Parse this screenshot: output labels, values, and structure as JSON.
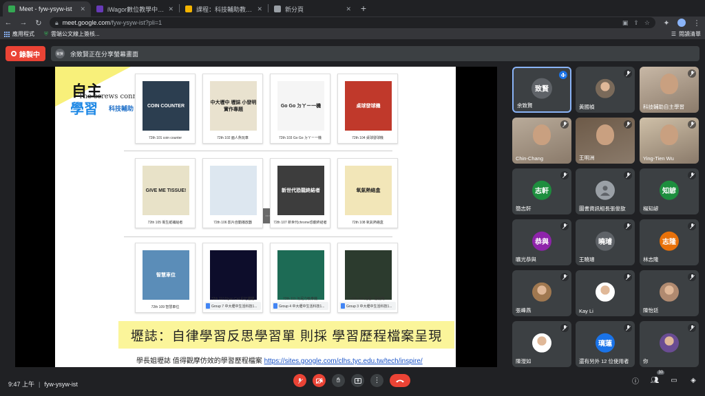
{
  "browser": {
    "tabs": [
      {
        "title": "Meet - fyw-ysyw-ist",
        "color": "#34a853",
        "active": true
      },
      {
        "title": "iWagor數位教學中心 » Categ",
        "color": "#673ab7",
        "active": false
      },
      {
        "title": "課程：科技輔助教學教案成果區",
        "color": "#f4b400",
        "active": false
      },
      {
        "title": "新分頁",
        "color": "#9aa0a6",
        "active": false
      }
    ],
    "new_tab": "+",
    "url_host": "meet.google.com",
    "url_path": "/fyw-ysyw-ist?pli=1",
    "bookmarks": [
      {
        "label": "應用程式"
      },
      {
        "label": "雲端公文線上簽核..."
      }
    ],
    "reading_list": "閱讀清單"
  },
  "meet": {
    "record_label": "錄製中",
    "share_avatar": "致賢",
    "share_banner": "余致賢正在分享螢幕畫面",
    "meeting_time": "9:47 上午",
    "meeting_code": "fyw-ysyw-ist",
    "people_count": "30"
  },
  "slide": {
    "title_black": "自主",
    "title_blue": "學習",
    "subtitle_en": "The screws connect the world",
    "subtitle_zh": "科技輔助",
    "cards_row1": [
      {
        "caption": "72th 101 coin counter",
        "thumb_text": "COIN COUNTER",
        "color": "#2c3e50"
      },
      {
        "caption": "72th 102 面人魚玩車",
        "thumb_text": "中大壢中 壢誌 小發明實作專題",
        "color": "#e9e2cf"
      },
      {
        "caption": "72th 103 Go Go ㄉㄚㄧ一機",
        "thumb_text": "Go Go ㄉㄚㄧ一機",
        "color": "#f5f5f5"
      },
      {
        "caption": "72th 104 桌球發球機",
        "thumb_text": "桌球發球機",
        "color": "#c0392b"
      }
    ],
    "cards_row2": [
      {
        "caption": "72th 105 衛生紙補給者",
        "thumb_text": "GIVE ME TISSUE!",
        "color": "#e8e2c8"
      },
      {
        "caption": "72th 106 影片自動播放器",
        "thumb_text": "",
        "color": "#dde7f0"
      },
      {
        "caption": "72th 107 新世代chrome恐龍終結者",
        "thumb_text": "新世代恐龍終結者",
        "color": "#3d3d3d"
      },
      {
        "caption": "72th 108 氧氣熱絡盒",
        "thumb_text": "氧氣熱絡盒",
        "color": "#f2e6b8"
      }
    ],
    "cards_row3": [
      {
        "caption": "72th 109 智慧車位",
        "thumb_text": "智慧車位",
        "color": "#5b8db8",
        "doc": ""
      },
      {
        "caption": "72th 110 Nyan Cat 彩虹貓貓",
        "thumb_text": "",
        "color": "#0d0d2b",
        "doc": "Group 7 中大壢中生活科技1..."
      },
      {
        "caption": "72th 111 污泥力吸車機",
        "thumb_text": "",
        "color": "#1d6b55",
        "doc": "Group 4 中大壢中生活科技1..."
      },
      {
        "caption": "72th 111 光遮 · 雷射筒",
        "thumb_text": "",
        "color": "#2c3b2e",
        "doc": "Group 3 中大壢中生活科技1..."
      }
    ],
    "banner": "壢誌：自律學習反思學習單 則採 學習歷程檔案呈現",
    "footer_text": "學長姐壢誌  值得觀摩仿效的學習歷程檔案  ",
    "footer_link": "https://sites.google.com/clhs.tyc.edu.tw/tech/inspire/",
    "overlay_left": "返回",
    "overlay_right": "⋯"
  },
  "participants": [
    {
      "name": "余致賢",
      "avatar": "致賢",
      "color": "#5f6368",
      "speaking": true,
      "video": false
    },
    {
      "name": "黃國禎",
      "avatar": "",
      "color": "#7a6a5a",
      "speaking": false,
      "video": false,
      "photo": true
    },
    {
      "name": "科技輔助自主學習",
      "avatar": "",
      "color": "#c8b8a6",
      "speaking": false,
      "video": true
    },
    {
      "name": "Chin-Chang",
      "avatar": "",
      "color": "#b9ab9a",
      "speaking": false,
      "video": true
    },
    {
      "name": "王明洲",
      "avatar": "",
      "color": "#6d5a48",
      "speaking": false,
      "video": true
    },
    {
      "name": "Ying-Tien Wu",
      "avatar": "",
      "color": "#cfc0a8",
      "speaking": false,
      "video": true
    },
    {
      "name": "簡志軒",
      "avatar": "志軒",
      "color": "#1e8e3e",
      "speaking": false,
      "video": false
    },
    {
      "name": "圖書資訊組長張俊歆",
      "avatar": "",
      "color": "#9aa0a6",
      "speaking": false,
      "video": false,
      "generic": true
    },
    {
      "name": "楊知諺",
      "avatar": "知諺",
      "color": "#1e8e3e",
      "speaking": false,
      "video": false
    },
    {
      "name": "曠光恭與",
      "avatar": "恭與",
      "color": "#8e24aa",
      "speaking": false,
      "video": false
    },
    {
      "name": "王曉璿",
      "avatar": "曉璿",
      "color": "#5f6368",
      "speaking": false,
      "video": false
    },
    {
      "name": "林志隆",
      "avatar": "志隆",
      "color": "#e8710a",
      "speaking": false,
      "video": false
    },
    {
      "name": "張峰燕",
      "avatar": "",
      "color": "#a07850",
      "speaking": false,
      "video": false,
      "photo": true
    },
    {
      "name": "Kay Li",
      "avatar": "",
      "color": "#ffffff",
      "speaking": false,
      "video": false,
      "photo": true
    },
    {
      "name": "陳怡廷",
      "avatar": "",
      "color": "#b08a70",
      "speaking": false,
      "video": false,
      "photo": true
    },
    {
      "name": "陳瀅如",
      "avatar": "",
      "color": "#ffffff",
      "speaking": false,
      "video": false,
      "photo": true
    },
    {
      "name": "還有另外 12 位使用者",
      "avatar": "璃蓮",
      "color": "#1a73e8",
      "speaking": false,
      "video": false
    },
    {
      "name": "你",
      "avatar": "",
      "color": "#6a4c93",
      "speaking": false,
      "video": false,
      "photo": true
    }
  ]
}
